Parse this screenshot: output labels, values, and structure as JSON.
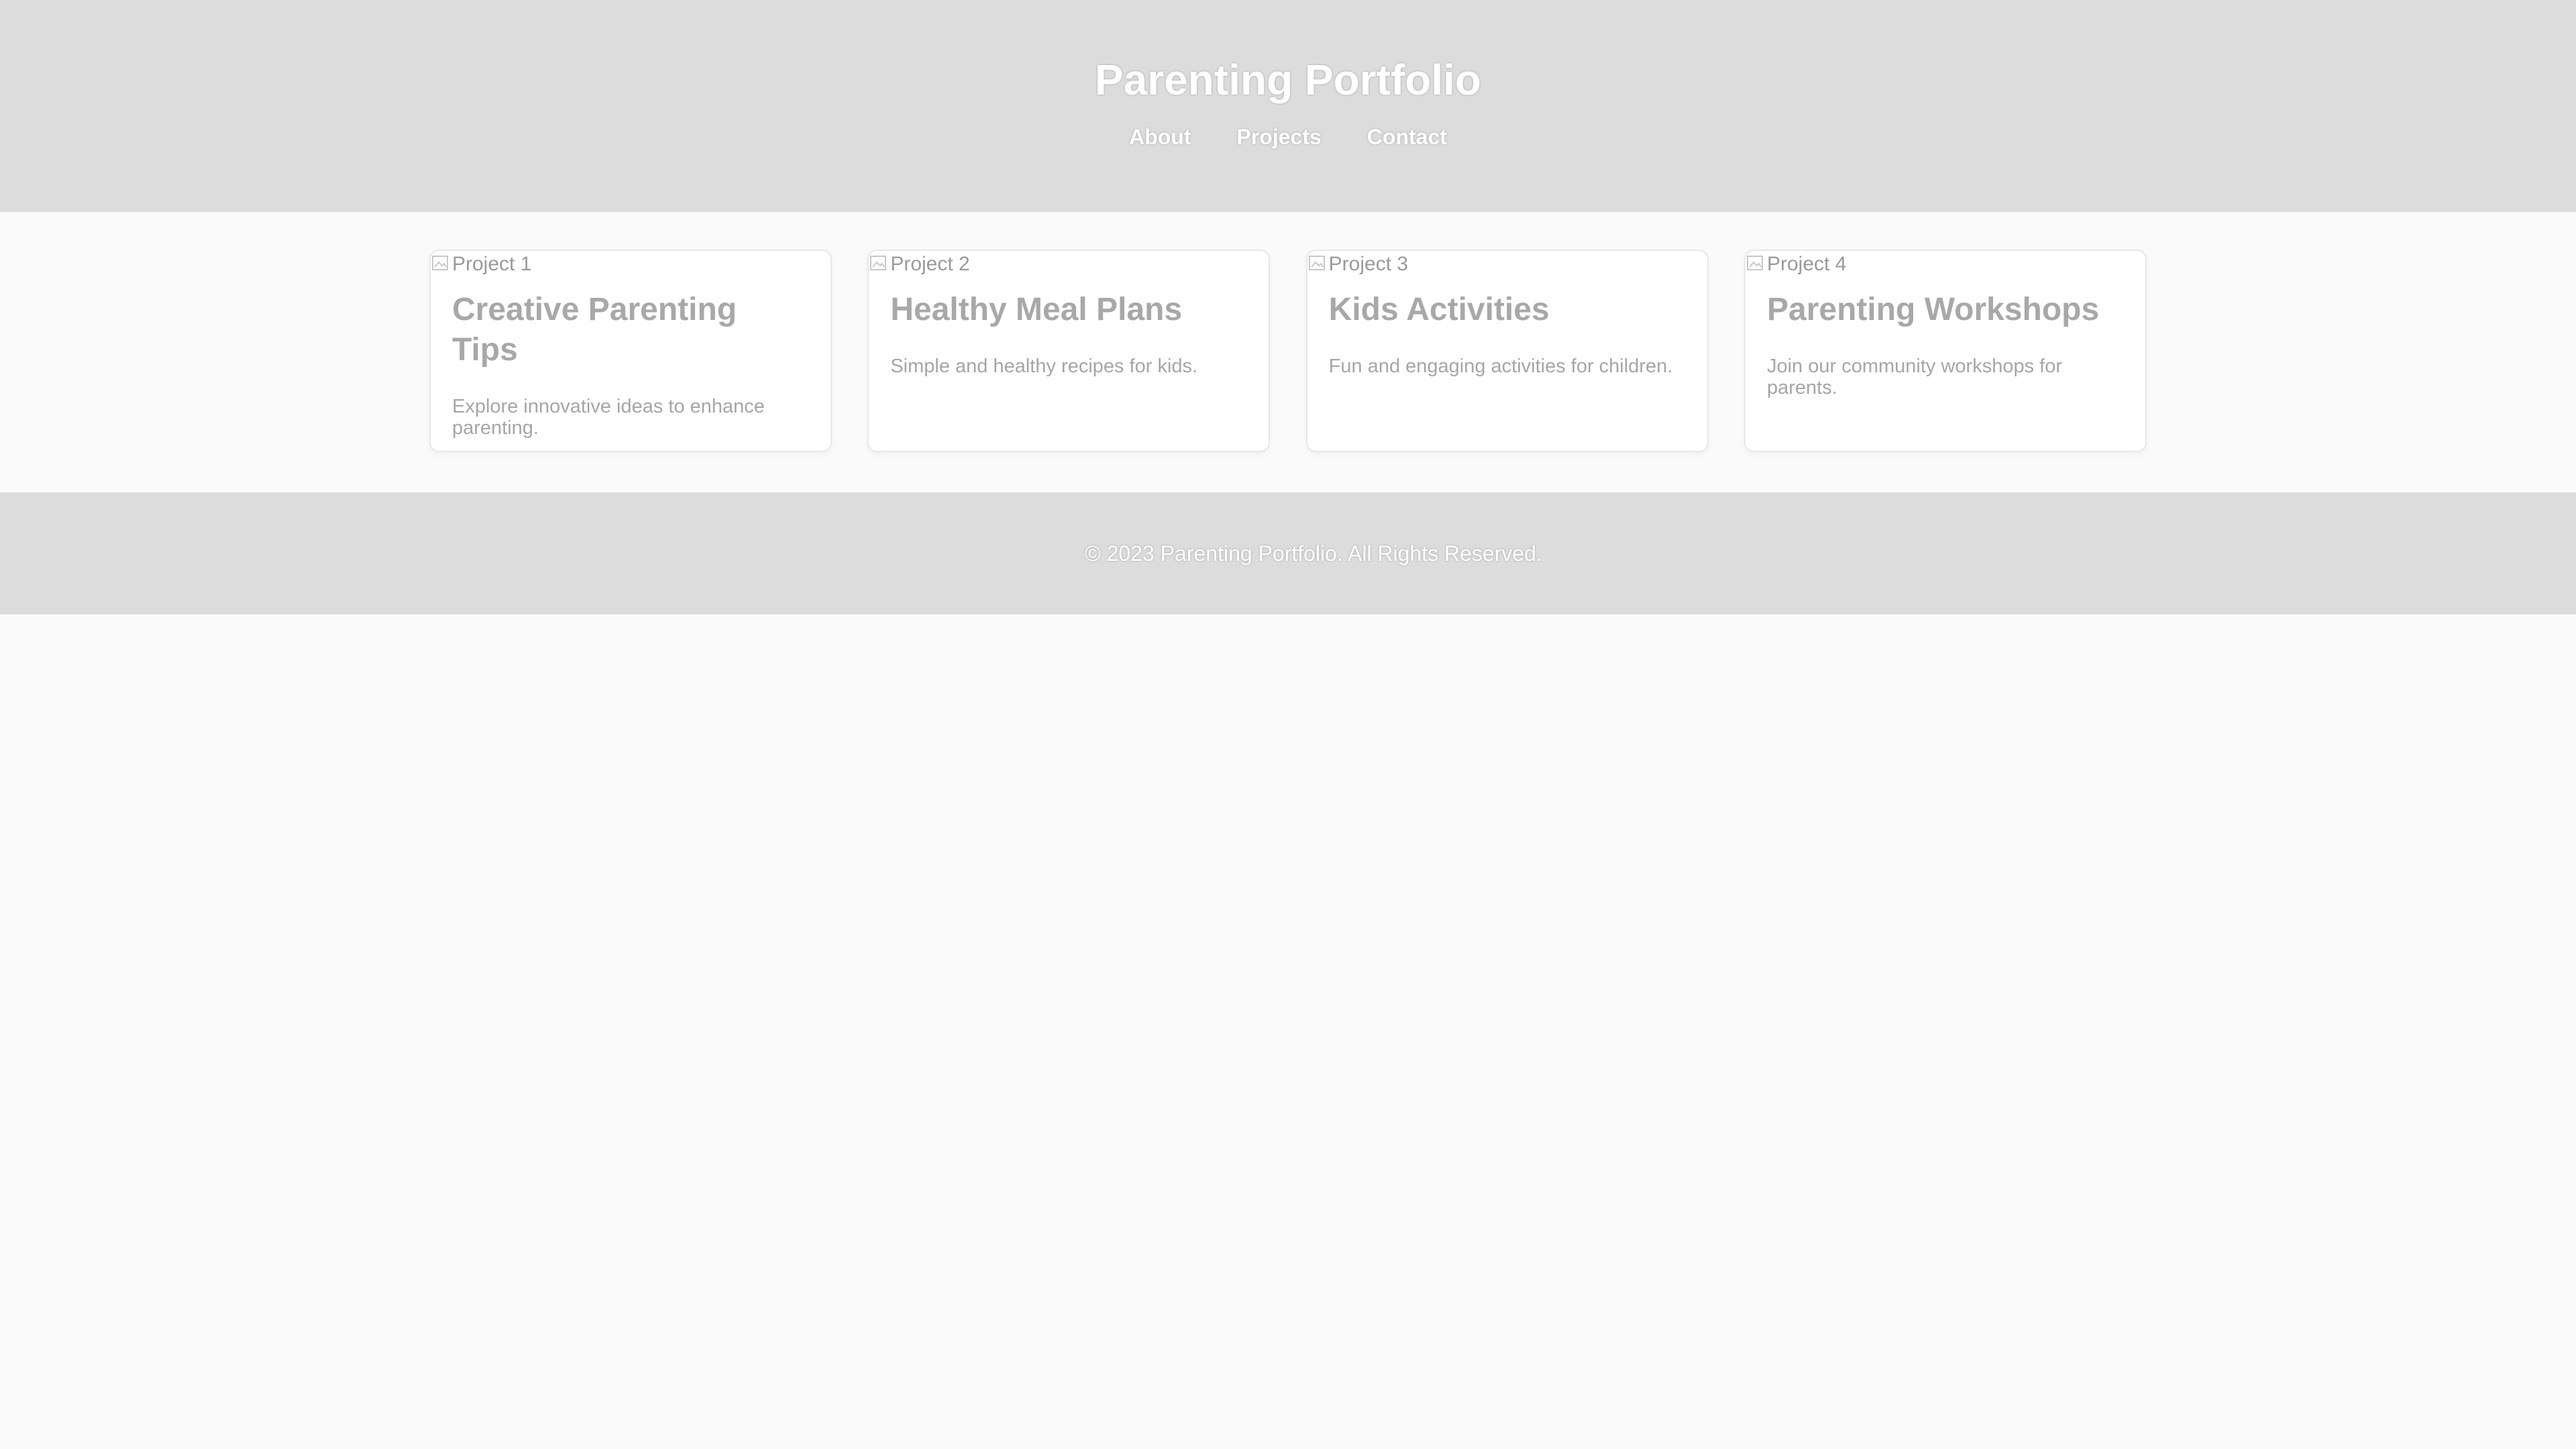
{
  "header": {
    "title": "Parenting Portfolio",
    "nav": [
      {
        "label": "About"
      },
      {
        "label": "Projects"
      },
      {
        "label": "Contact"
      }
    ]
  },
  "projects": [
    {
      "image_alt": "Project 1",
      "title": "Creative Parenting Tips",
      "description": "Explore innovative ideas to enhance parenting."
    },
    {
      "image_alt": "Project 2",
      "title": "Healthy Meal Plans",
      "description": "Simple and healthy recipes for kids."
    },
    {
      "image_alt": "Project 3",
      "title": "Kids Activities",
      "description": "Fun and engaging activities for children."
    },
    {
      "image_alt": "Project 4",
      "title": "Parenting Workshops",
      "description": "Join our community workshops for parents."
    }
  ],
  "footer": {
    "text": "© 2023 Parenting Portfolio. All Rights Reserved."
  },
  "colors": {
    "header_bg": "#dcdcdc",
    "page_bg": "#fafafa",
    "card_bg": "#ffffff",
    "card_text": "#a8a8a8"
  },
  "icons": {
    "broken_image": "broken-image-icon"
  }
}
